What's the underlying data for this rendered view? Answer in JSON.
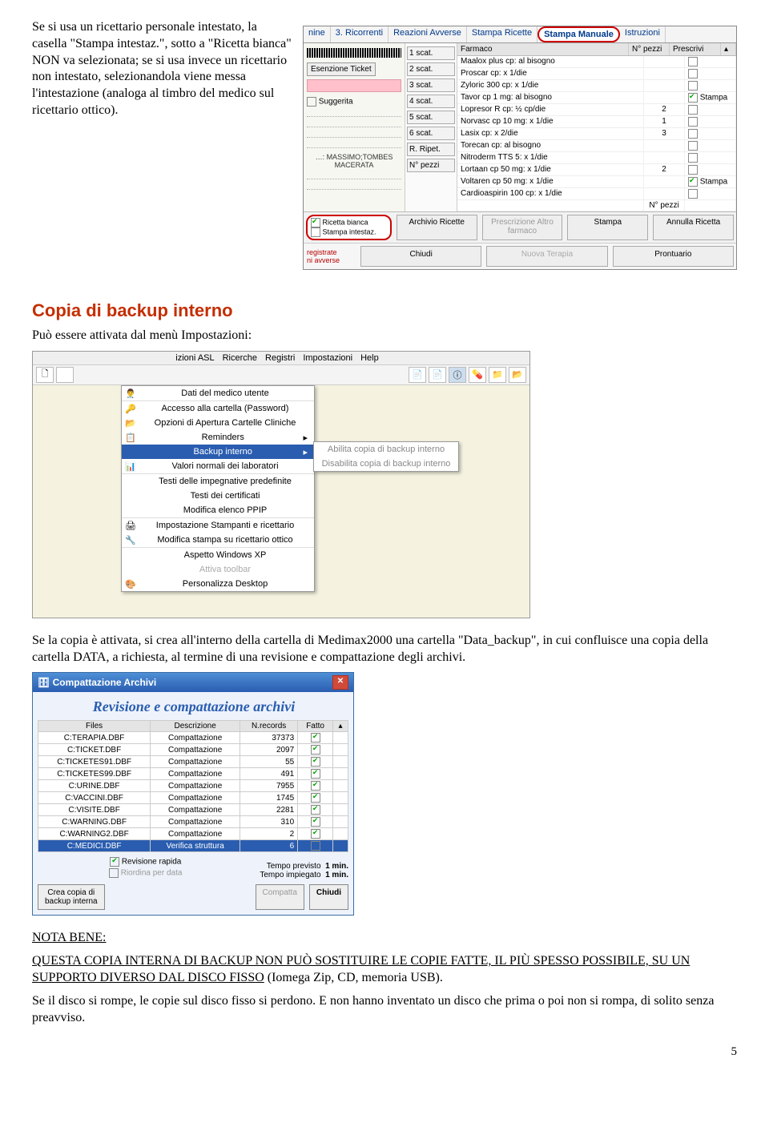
{
  "intro_paragraph": "Se si usa un ricettario personale intestato, la casella \"Stampa intestaz.\", sotto a \"Ricetta bianca\" NON va selezionata; se si usa invece un ricettario non intestato, selezionandola viene messa l'intestazione (analoga al timbro del medico sul ricettario ottico).",
  "s1": {
    "tabs": [
      "nine",
      "3. Ricorrenti",
      "Reazioni Avverse",
      "Stampa Ricette",
      "Stampa Manuale",
      "Istruzioni"
    ],
    "selected_tab": "Stampa Manuale",
    "left": {
      "ticket_btn": "Esenzione Ticket",
      "suggerita": "Suggerita",
      "macerata_top": "…: MASSIMO;TOMBES",
      "macerata": "MACERATA"
    },
    "mid_buttons": [
      "1 scat.",
      "2 scat.",
      "3 scat.",
      "4 scat.",
      "5 scat.",
      "6 scat.",
      "R. Ripet.",
      "N° pezzi"
    ],
    "headers": [
      "Farmaco",
      "N° pezzi",
      "Prescrivi"
    ],
    "rows": [
      {
        "f": "Maalox plus cp: al bisogno",
        "n": "",
        "p": false,
        "pw": ""
      },
      {
        "f": "Proscar cp: x 1/die",
        "n": "",
        "p": false,
        "pw": ""
      },
      {
        "f": "Zyloric 300 cp: x 1/die",
        "n": "",
        "p": false,
        "pw": ""
      },
      {
        "f": "Tavor cp 1 mg: al bisogno",
        "n": "",
        "p": true,
        "pw": "Stampa"
      },
      {
        "f": "Lopresor R cp: ½ cp/die",
        "n": "2",
        "p": false,
        "pw": ""
      },
      {
        "f": "Norvasc cp 10 mg: x 1/die",
        "n": "1",
        "p": false,
        "pw": ""
      },
      {
        "f": "Lasix cp: x 2/die",
        "n": "3",
        "p": false,
        "pw": ""
      },
      {
        "f": "Torecan cp: al bisogno",
        "n": "",
        "p": false,
        "pw": ""
      },
      {
        "f": "Nitroderm TTS 5: x 1/die",
        "n": "",
        "p": false,
        "pw": ""
      },
      {
        "f": "Lortaan cp 50 mg: x 1/die",
        "n": "2",
        "p": false,
        "pw": ""
      },
      {
        "f": "Voltaren cp 50 mg: x 1/die",
        "n": "",
        "p": true,
        "pw": "Stampa"
      },
      {
        "f": "Cardioaspirin 100 cp: x 1/die",
        "n": "",
        "p": false,
        "pw": ""
      }
    ],
    "npezzi_label": "N° pezzi",
    "ricetta_box": {
      "l1": "Ricetta bianca",
      "l2": "Stampa intestaz."
    },
    "foot_buttons": [
      "Archivio Ricette",
      "Prescrizione Altro farmaco",
      "Stampa",
      "Annulla Ricetta"
    ],
    "bottom": {
      "reg": "registrate\nni avverse",
      "chiudi": "Chiudi",
      "nuova": "Nuova Terapia",
      "prontuario": "Prontuario"
    }
  },
  "heading_backup": "Copia di backup interno",
  "backup_intro": "Può essere attivata dal menù Impostazioni:",
  "s2": {
    "menubar": [
      "izioni ASL",
      "Ricerche",
      "Registri",
      "Impostazioni",
      "Help"
    ],
    "menu_items": [
      {
        "t": "Dati del medico utente",
        "ic": "👨‍⚕️"
      },
      {
        "t": "Accesso alla cartella (Password)",
        "ic": "🔑",
        "sep": true
      },
      {
        "t": "Opzioni di Apertura Cartelle Cliniche",
        "ic": "📂"
      },
      {
        "t": "Reminders",
        "ic": "📋",
        "arrow": true
      },
      {
        "t": "Backup interno",
        "ic": "",
        "arrow": true,
        "hl": true
      },
      {
        "t": "Valori normali dei laboratori",
        "ic": "📊"
      },
      {
        "t": "Testi delle impegnative predefinite",
        "ic": "",
        "sep": true
      },
      {
        "t": "Testi dei certificati",
        "ic": ""
      },
      {
        "t": "Modifica elenco PPIP",
        "ic": ""
      },
      {
        "t": "Impostazione Stampanti e ricettario",
        "ic": "🖨",
        "sep": true
      },
      {
        "t": "Modifica stampa su ricettario ottico",
        "ic": "🔧"
      },
      {
        "t": "Aspetto Windows XP",
        "ic": "",
        "sep": true
      },
      {
        "t": "Attiva toolbar",
        "ic": "",
        "dim": true
      },
      {
        "t": "Personalizza Desktop",
        "ic": "🎨"
      }
    ],
    "submenu": [
      "Abilita copia di backup interno",
      "Disabilita copia di backup interno"
    ]
  },
  "backup_body": "Se la copia è attivata, si crea all'interno della cartella di Medimax2000 una cartella \"Data_backup\", in cui confluisce una copia della cartella DATA, a richiesta, al termine di una revisione e compattazione degli archivi.",
  "s3": {
    "title": "Compattazione Archivi",
    "heading": "Revisione e compattazione archivi",
    "cols": [
      "Files",
      "Descrizione",
      "N.records",
      "Fatto"
    ],
    "rows": [
      {
        "f": "C:TERAPIA.DBF",
        "d": "Compattazione",
        "n": "37373",
        "c": true
      },
      {
        "f": "C:TICKET.DBF",
        "d": "Compattazione",
        "n": "2097",
        "c": true
      },
      {
        "f": "C:TICKETES91.DBF",
        "d": "Compattazione",
        "n": "55",
        "c": true
      },
      {
        "f": "C:TICKETES99.DBF",
        "d": "Compattazione",
        "n": "491",
        "c": true
      },
      {
        "f": "C:URINE.DBF",
        "d": "Compattazione",
        "n": "7955",
        "c": true
      },
      {
        "f": "C:VACCINI.DBF",
        "d": "Compattazione",
        "n": "1745",
        "c": true
      },
      {
        "f": "C:VISITE.DBF",
        "d": "Compattazione",
        "n": "2281",
        "c": true
      },
      {
        "f": "C:WARNING.DBF",
        "d": "Compattazione",
        "n": "310",
        "c": true
      },
      {
        "f": "C:WARNING2.DBF",
        "d": "Compattazione",
        "n": "2",
        "c": true
      },
      {
        "f": "C:MEDICI.DBF",
        "d": "Verifica struttura",
        "n": "6",
        "c": false,
        "sel": true
      }
    ],
    "chk1": "Revisione rapida",
    "chk2": "Riordina per data",
    "tempo_prev_lbl": "Tempo previsto",
    "tempo_prev": "1 min.",
    "tempo_imp_lbl": "Tempo impiegato",
    "tempo_imp": "1 min.",
    "btn_crea": "Crea copia di\nbackup interna",
    "btn_compatta": "Compatta",
    "btn_chiudi": "Chiudi"
  },
  "nota_label": "NOTA BENE:",
  "nota_p1_a": "QUESTA COPIA INTERNA DI BACKUP NON PUÒ SOSTITUIRE LE COPIE FATTE, IL PIÙ SPESSO POSSIBILE, SU UN SUPPORTO DIVERSO DAL DISCO FISSO",
  "nota_p1_b": " (Iomega Zip, CD, memoria USB).",
  "nota_p2": "Se il disco si rompe, le copie sul disco fisso si perdono. E non hanno inventato un disco che prima o poi non si rompa, di solito senza preavviso.",
  "page_number": "5"
}
